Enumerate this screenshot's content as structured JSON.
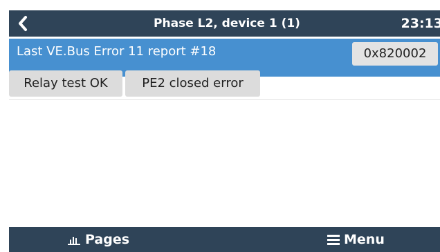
{
  "header": {
    "title": "Phase L2, device 1 (1)",
    "time": "23:13",
    "back_icon": "chevron-left-icon"
  },
  "error_row": {
    "label": "Last VE.Bus Error 11 report #18",
    "value": "0x820002",
    "highlight_color": "#4790d0"
  },
  "status_tags": [
    {
      "label": "Relay test OK"
    },
    {
      "label": "PE2 closed error"
    }
  ],
  "footer": {
    "pages_label": "Pages",
    "pages_icon": "bar-chart-icon",
    "menu_label": "Menu",
    "menu_icon": "hamburger-menu-icon"
  },
  "colors": {
    "bar_background": "#2f4458",
    "chip_background": "#dcdcdc"
  }
}
